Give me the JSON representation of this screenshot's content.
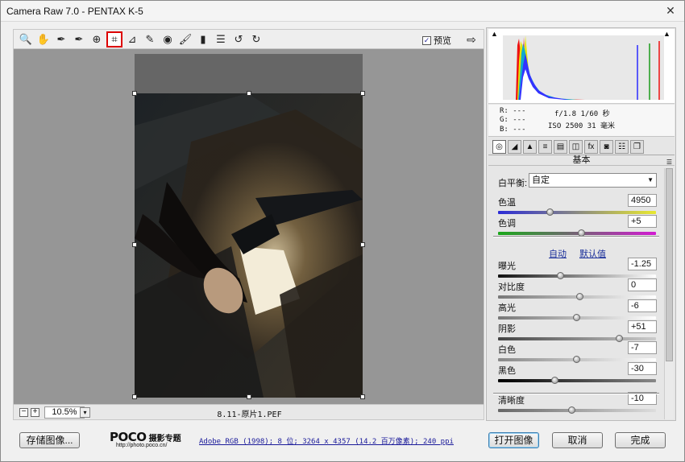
{
  "window": {
    "title": "Camera Raw 7.0 -  PENTAX K-5",
    "close": "✕"
  },
  "toolbar": {
    "tools": [
      {
        "name": "zoom-tool-icon",
        "glyph": "🔍"
      },
      {
        "name": "hand-tool-icon",
        "glyph": "✋"
      },
      {
        "name": "white-balance-tool-icon",
        "glyph": "✒"
      },
      {
        "name": "color-sampler-tool-icon",
        "glyph": "✒"
      },
      {
        "name": "targeted-adjustment-tool-icon",
        "glyph": "⊕"
      },
      {
        "name": "crop-tool-icon",
        "glyph": "⌗"
      },
      {
        "name": "straighten-tool-icon",
        "glyph": "⊿"
      },
      {
        "name": "spot-removal-tool-icon",
        "glyph": "✎"
      },
      {
        "name": "red-eye-tool-icon",
        "glyph": "◉"
      },
      {
        "name": "adjustment-brush-icon",
        "glyph": "🖌"
      },
      {
        "name": "graduated-filter-icon",
        "glyph": "▮"
      },
      {
        "name": "preferences-icon",
        "glyph": "☰"
      },
      {
        "name": "rotate-left-icon",
        "glyph": "↺"
      },
      {
        "name": "rotate-right-icon",
        "glyph": "↻"
      }
    ],
    "active_tool": "crop-tool-icon",
    "preview_label": "预览",
    "preview_checked": "✓"
  },
  "status": {
    "zoom_minus": "−",
    "zoom_plus": "+",
    "zoom_value": "10.5%",
    "zoom_dropdown": "▾",
    "filename": "8.11-原片1.PEF"
  },
  "info": {
    "r": "R:  ---",
    "g": "G:  ---",
    "b": "B:  ---",
    "exposure_line": "f/1.8   1/60 秒",
    "iso_line": "ISO 2500   31 毫米"
  },
  "panel": {
    "section_title": "基本",
    "white_balance_label": "白平衡:",
    "white_balance_value": "自定",
    "auto_label": "自动",
    "default_label": "默认值",
    "sliders": [
      {
        "id": "temp",
        "label": "色温",
        "value": "4950",
        "pos": 0.33
      },
      {
        "id": "tint",
        "label": "色调",
        "value": "+5",
        "pos": 0.53
      },
      {
        "id": "exposure",
        "label": "曝光",
        "value": "-1.25",
        "pos": 0.4
      },
      {
        "id": "contrast",
        "label": "对比度",
        "value": "0",
        "pos": 0.52
      },
      {
        "id": "highlights",
        "label": "高光",
        "value": "-6",
        "pos": 0.5
      },
      {
        "id": "shadows",
        "label": "阴影",
        "value": "+51",
        "pos": 0.77
      },
      {
        "id": "whites",
        "label": "白色",
        "value": "-7",
        "pos": 0.5
      },
      {
        "id": "blacks",
        "label": "黑色",
        "value": "-30",
        "pos": 0.36
      },
      {
        "id": "clarity",
        "label": "清晰度",
        "value": "-10",
        "pos": 0.47
      }
    ]
  },
  "bottom": {
    "save_label": "存储图像...",
    "logo_brand": "POCO",
    "logo_sub": "摄影专题",
    "logo_url": "http://photo.poco.cn/",
    "metadata_link": "Adobe RGB (1998); 8 位; 3264 x 4357 (14.2 百万像素); 240 ppi",
    "open_label": "打开图像",
    "cancel_label": "取消",
    "done_label": "完成"
  }
}
